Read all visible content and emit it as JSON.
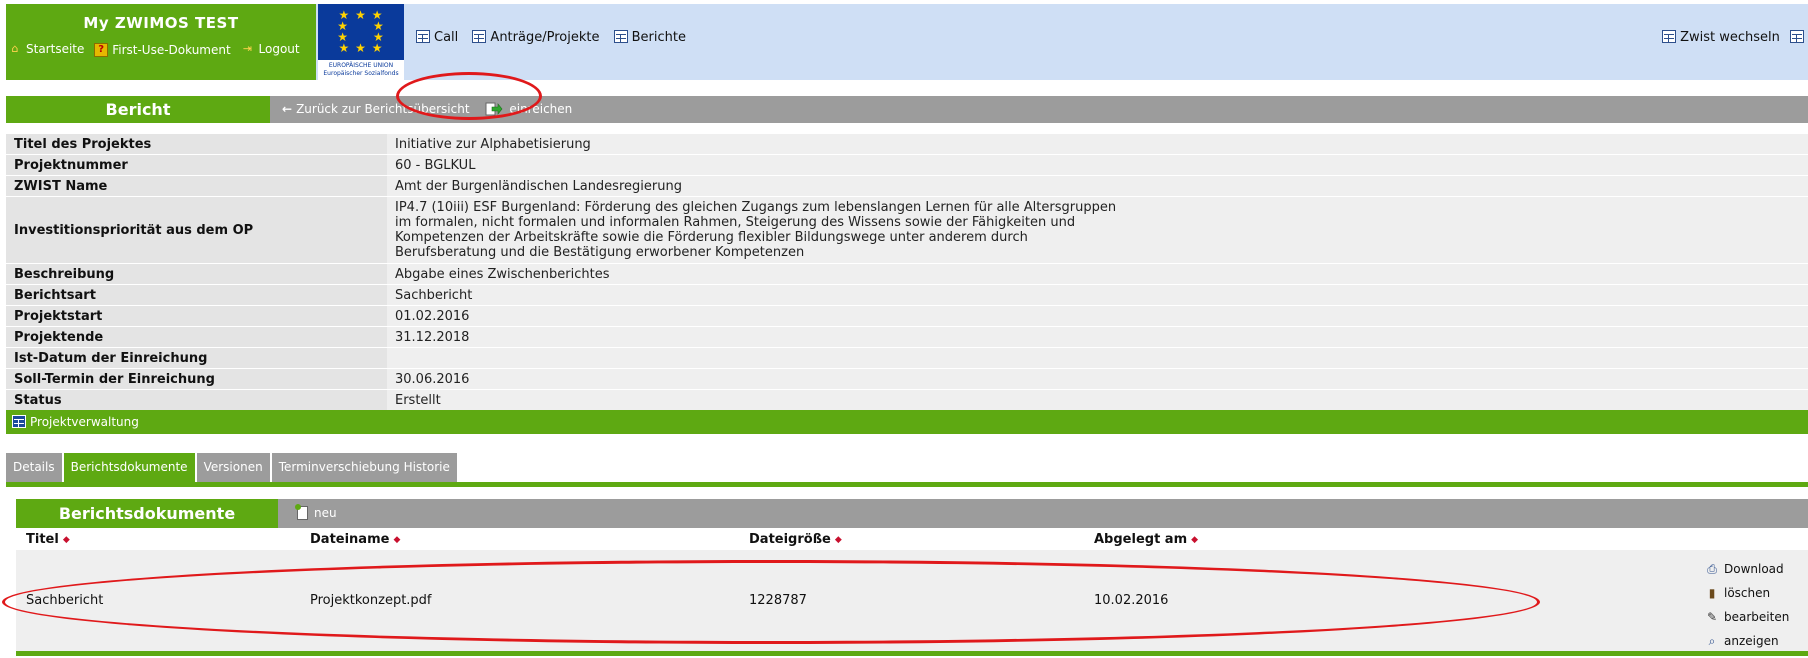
{
  "header": {
    "app_title": "My ZWIMOS TEST",
    "links": [
      {
        "label": "Startseite",
        "icon": "home-icon"
      },
      {
        "label": "First-Use-Dokument",
        "icon": "help-icon"
      },
      {
        "label": "Logout",
        "icon": "logout-icon"
      }
    ],
    "eu_logo_caption": "EUROPÄISCHE UNION",
    "eu_logo_subcaption": "Europäischer Sozialfonds",
    "nav": [
      "Call",
      "Anträge/Projekte",
      "Berichte"
    ],
    "right_link": "Zwist wechseln"
  },
  "bericht": {
    "title": "Bericht",
    "back_label": "Zurück zur Berichtsübersicht",
    "submit_label": "einreichen"
  },
  "info_rows": [
    {
      "label": "Titel des Projektes",
      "value": "Initiative zur Alphabetisierung"
    },
    {
      "label": "Projektnummer",
      "value": "60 - BGLKUL"
    },
    {
      "label": "ZWIST Name",
      "value": "Amt der Burgenländischen Landesregierung"
    },
    {
      "label": "Investitionspriorität aus dem OP",
      "value_lines": [
        "IP4.7 (10iii) ESF Burgenland: Förderung des gleichen Zugangs zum lebenslangen Lernen für alle Altersgruppen",
        "im formalen, nicht formalen und informalen Rahmen, Steigerung des Wissens sowie der Fähigkeiten und",
        "Kompetenzen der Arbeitskräfte sowie die Förderung flexibler Bildungswege unter anderem durch",
        "Berufsberatung und die Bestätigung erworbener Kompetenzen"
      ]
    },
    {
      "label": "Beschreibung",
      "value": "Abgabe eines Zwischenberichtes"
    },
    {
      "label": "Berichtsart",
      "value": "Sachbericht"
    },
    {
      "label": "Projektstart",
      "value": "01.02.2016"
    },
    {
      "label": "Projektende",
      "value": "31.12.2018"
    },
    {
      "label": "Ist-Datum der Einreichung",
      "value": ""
    },
    {
      "label": "Soll-Termin der Einreichung",
      "value": "30.06.2016"
    },
    {
      "label": "Status",
      "value": "Erstellt"
    }
  ],
  "projektverwaltung": {
    "label": "Projektverwaltung"
  },
  "tabs": [
    {
      "label": "Details",
      "active": false
    },
    {
      "label": "Berichtsdokumente",
      "active": true
    },
    {
      "label": "Versionen",
      "active": false
    },
    {
      "label": "Terminverschiebung Historie",
      "active": false
    }
  ],
  "documents": {
    "title": "Berichtsdokumente",
    "new_label": "neu",
    "columns": [
      "Titel",
      "Dateiname",
      "Dateigröße",
      "Abgelegt am"
    ],
    "sort_marker": "◆",
    "rows": [
      {
        "titel": "Sachbericht",
        "dateiname": "Projektkonzept.pdf",
        "dateigroesse": "1228787",
        "abgelegt_am": "10.02.2016"
      }
    ],
    "row_actions": [
      {
        "label": "Download",
        "icon": "download-icon"
      },
      {
        "label": "löschen",
        "icon": "trash-icon"
      },
      {
        "label": "bearbeiten",
        "icon": "edit-icon"
      },
      {
        "label": "anzeigen",
        "icon": "view-icon"
      }
    ]
  },
  "colors": {
    "green": "#5ea912",
    "header_blue": "#cfdff5",
    "gray_bar": "#9c9c9c",
    "annotation_red": "#e0191b"
  }
}
